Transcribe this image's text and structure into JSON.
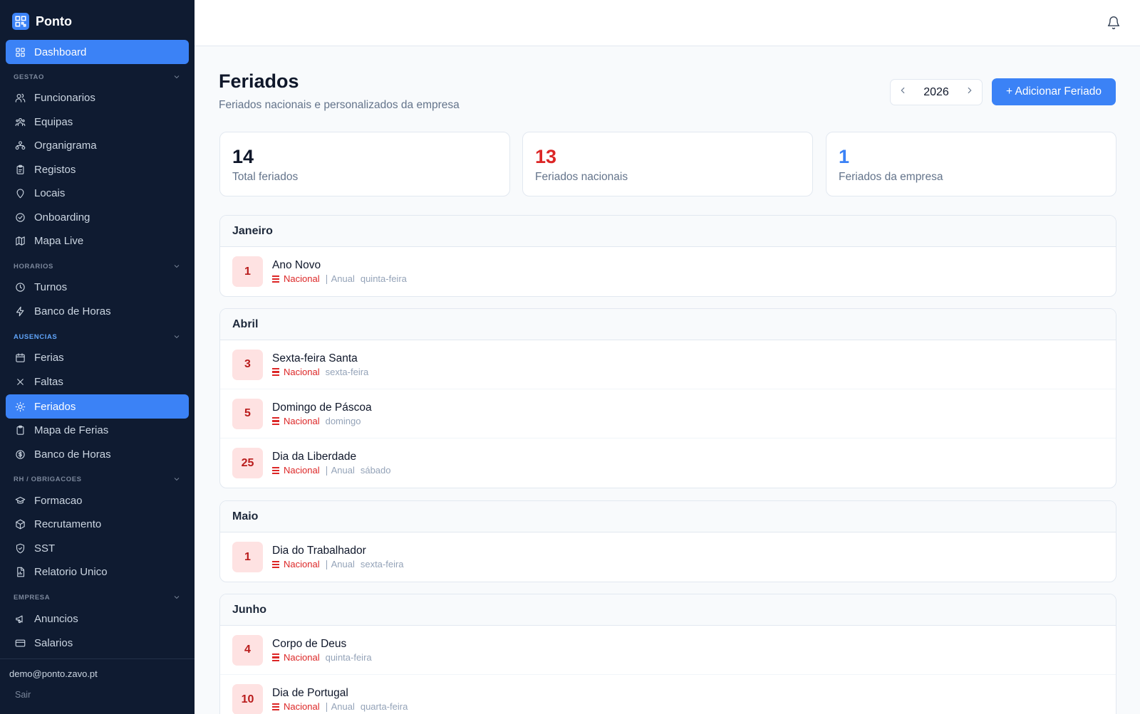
{
  "app": {
    "name": "Ponto"
  },
  "sidebar": {
    "dashboard": "Dashboard",
    "sections": [
      {
        "title": "GESTAO",
        "items": [
          "Funcionarios",
          "Equipas",
          "Organigrama",
          "Registos",
          "Locais",
          "Onboarding",
          "Mapa Live"
        ]
      },
      {
        "title": "HORARIOS",
        "items": [
          "Turnos",
          "Banco de Horas"
        ]
      },
      {
        "title": "AUSENCIAS",
        "items": [
          "Ferias",
          "Faltas",
          "Feriados",
          "Mapa de Ferias",
          "Banco de Horas"
        ]
      },
      {
        "title": "RH / OBRIGACOES",
        "items": [
          "Formacao",
          "Recrutamento",
          "SST",
          "Relatorio Unico"
        ]
      },
      {
        "title": "EMPRESA",
        "items": [
          "Anuncios",
          "Salarios"
        ]
      }
    ],
    "active_item": "Feriados",
    "user_email": "demo@ponto.zavo.pt",
    "logout": "Sair"
  },
  "header": {
    "title": "Feriados",
    "subtitle": "Feriados nacionais e personalizados da empresa",
    "year": "2026",
    "add_button": "+ Adicionar Feriado"
  },
  "stats": [
    {
      "value": "14",
      "label": "Total feriados",
      "color": "#0f172a"
    },
    {
      "value": "13",
      "label": "Feriados nacionais",
      "color": "#dc2626"
    },
    {
      "value": "1",
      "label": "Feriados da empresa",
      "color": "#3b82f6"
    }
  ],
  "months": [
    {
      "name": "Janeiro",
      "holidays": [
        {
          "day": "1",
          "name": "Ano Novo",
          "type": "Nacional",
          "recurrence": "Anual",
          "weekday": "quinta-feira"
        }
      ]
    },
    {
      "name": "Abril",
      "holidays": [
        {
          "day": "3",
          "name": "Sexta-feira Santa",
          "type": "Nacional",
          "recurrence": "",
          "weekday": "sexta-feira"
        },
        {
          "day": "5",
          "name": "Domingo de Páscoa",
          "type": "Nacional",
          "recurrence": "",
          "weekday": "domingo"
        },
        {
          "day": "25",
          "name": "Dia da Liberdade",
          "type": "Nacional",
          "recurrence": "Anual",
          "weekday": "sábado"
        }
      ]
    },
    {
      "name": "Maio",
      "holidays": [
        {
          "day": "1",
          "name": "Dia do Trabalhador",
          "type": "Nacional",
          "recurrence": "Anual",
          "weekday": "sexta-feira"
        }
      ]
    },
    {
      "name": "Junho",
      "holidays": [
        {
          "day": "4",
          "name": "Corpo de Deus",
          "type": "Nacional",
          "recurrence": "",
          "weekday": "quinta-feira"
        },
        {
          "day": "10",
          "name": "Dia de Portugal",
          "type": "Nacional",
          "recurrence": "Anual",
          "weekday": "quarta-feira"
        }
      ]
    }
  ],
  "icons": {
    "dashboard": "grid-icon",
    "Funcionarios": "users-icon",
    "Equipas": "team-icon",
    "Organigrama": "org-chart-icon",
    "Registos": "clipboard-icon",
    "Locais": "location-pin-icon",
    "Onboarding": "check-circle-icon",
    "Mapa Live": "map-icon",
    "Turnos": "clock-icon",
    "Banco de Horas": "lightning-icon",
    "Ferias": "calendar-icon",
    "Faltas": "x-icon",
    "Feriados": "sun-icon",
    "Mapa de Ferias": "clipboard-icon",
    "Banco de Horas 2": "dollar-circle-icon",
    "Formacao": "graduation-cap-icon",
    "Recrutamento": "box-icon",
    "SST": "shield-icon",
    "Relatorio Unico": "report-icon",
    "Anuncios": "megaphone-icon",
    "Salarios": "credit-card-icon"
  },
  "colors": {
    "sidebar_bg": "#0f1b31",
    "accent": "#3b82f6",
    "national": "#dc2626"
  }
}
